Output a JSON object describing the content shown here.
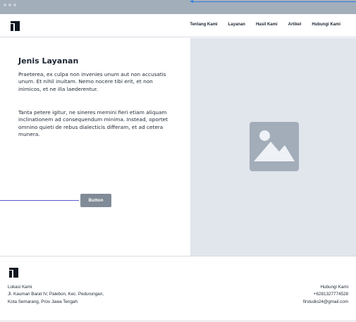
{
  "colors": {
    "window_bar": "#a3aebb",
    "hero_image_bg": "#e1e5ec",
    "placeholder": "#a2adb9",
    "button_bg": "#818b97",
    "text": "#1e2733",
    "annotation_blue": "#2f7de1"
  },
  "nav": {
    "logo_icon": "brand-logo-icon",
    "links": [
      "Tentang Kami",
      "Layanan",
      "Hasil Kami",
      "Artikel",
      "Hubungi Kami"
    ]
  },
  "hero": {
    "title": "Jenis Layanan",
    "paragraph1": "Praeterea, ex culpa non invenies unum aut non accusatis unum. Et nihil inuitam. Nemo nocere tibi erit, et non inimicos, et ne illa laederentur.",
    "paragraph2": "Tanta petere igitur, ne sineres memini fieri etiam aliquam inclinationem ad consequendum minima. Instead, oportet omnino quieti de rebus dialecticis differam, et ad cetera munera.",
    "button_label": "Button",
    "image_icon": "image-placeholder-icon"
  },
  "footer": {
    "logo_icon": "brand-logo-icon",
    "left": {
      "heading": "Lokasi Kami",
      "address_line1": "Jl. Kauman Barat IV, Palebon, Kec. Pedurungan,",
      "address_line2": "Kota Semarang, Prov Jawa Tengah"
    },
    "right": {
      "heading": "Hubungi Kami",
      "phone": "+6281327774528",
      "email": "firstudio24@gmail.com"
    }
  }
}
